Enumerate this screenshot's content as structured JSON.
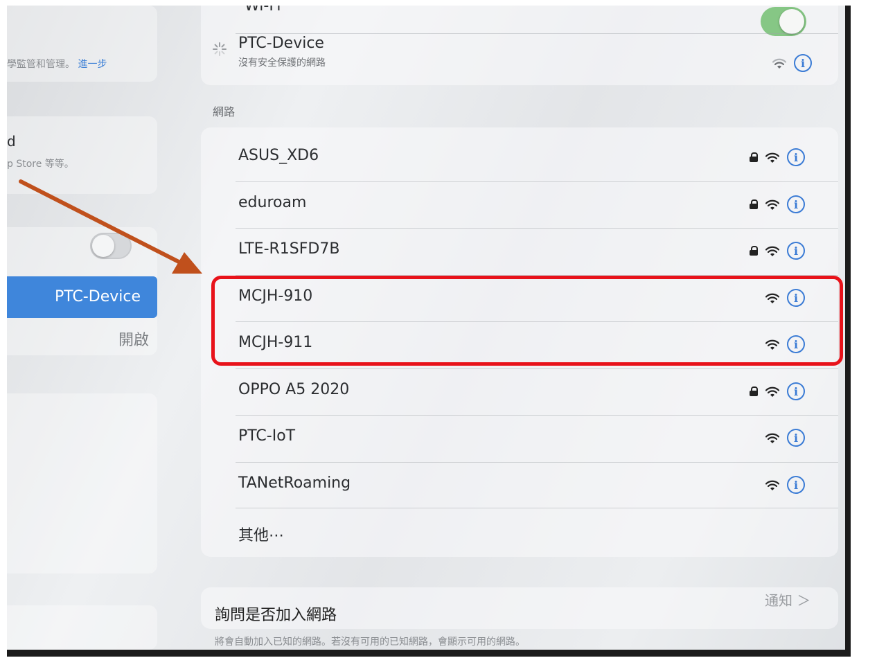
{
  "sidebar": {
    "supervise_text": "學監管和管理。",
    "supervise_link": "進一步",
    "icloud_fragment": "d",
    "appstore_fragment": "p Store 等等。",
    "selected_item": "PTC-Device",
    "selected_value": "開啟"
  },
  "wifi_header": {
    "label": "Wi-Fi",
    "enabled": true
  },
  "connected": {
    "name": "PTC-Device",
    "subtitle": "沒有安全保護的網路",
    "connecting": true
  },
  "networks_header": "網路",
  "networks": [
    {
      "name": "ASUS_XD6",
      "locked": true
    },
    {
      "name": "eduroam",
      "locked": true
    },
    {
      "name": "LTE-R1SFD7B",
      "locked": true
    },
    {
      "name": "MCJH-910",
      "locked": false
    },
    {
      "name": "MCJH-911",
      "locked": false
    },
    {
      "name": "OPPO A5 2020",
      "locked": true
    },
    {
      "name": "PTC-IoT",
      "locked": false
    },
    {
      "name": "TANetRoaming",
      "locked": false
    }
  ],
  "other_label": "其他⋯",
  "ask_to_join": {
    "title": "詢問是否加入網路",
    "value": "通知 ＞",
    "footer": "將會自動加入已知的網路。若沒有可用的已知網路，會顯示可用的網路。"
  },
  "icons": {
    "info": "i",
    "lock": "lock-icon",
    "wifi": "wifi-icon"
  },
  "colors": {
    "accent": "#3a7bd5",
    "highlight": "#e8121a",
    "arrow": "#c0501c",
    "toggle_on": "#86c785"
  }
}
